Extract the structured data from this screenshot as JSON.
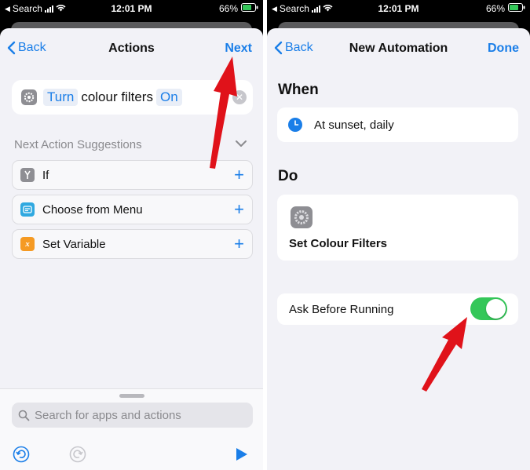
{
  "status": {
    "carrier": "Search",
    "time": "12:01 PM",
    "battery": "66%"
  },
  "left": {
    "nav": {
      "back": "Back",
      "title": "Actions",
      "next": "Next"
    },
    "action": {
      "token1": "Turn",
      "text": "colour filters",
      "token2": "On"
    },
    "suggestions_header": "Next Action Suggestions",
    "suggestions": [
      {
        "label": "If",
        "icon": "branch-icon",
        "color": "#8e8e93"
      },
      {
        "label": "Choose from Menu",
        "icon": "menu-icon",
        "color": "#2fa8e0"
      },
      {
        "label": "Set Variable",
        "icon": "variable-icon",
        "color": "#f59a23"
      }
    ],
    "search_placeholder": "Search for apps and actions"
  },
  "right": {
    "nav": {
      "back": "Back",
      "title": "New Automation",
      "done": "Done"
    },
    "when_label": "When",
    "trigger": "At sunset, daily",
    "do_label": "Do",
    "action": "Set Colour Filters",
    "ask_label": "Ask Before Running",
    "ask_enabled": true
  },
  "colors": {
    "accent": "#1a7ee8",
    "toggle_on": "#34c759",
    "arrow": "#e0121a"
  }
}
